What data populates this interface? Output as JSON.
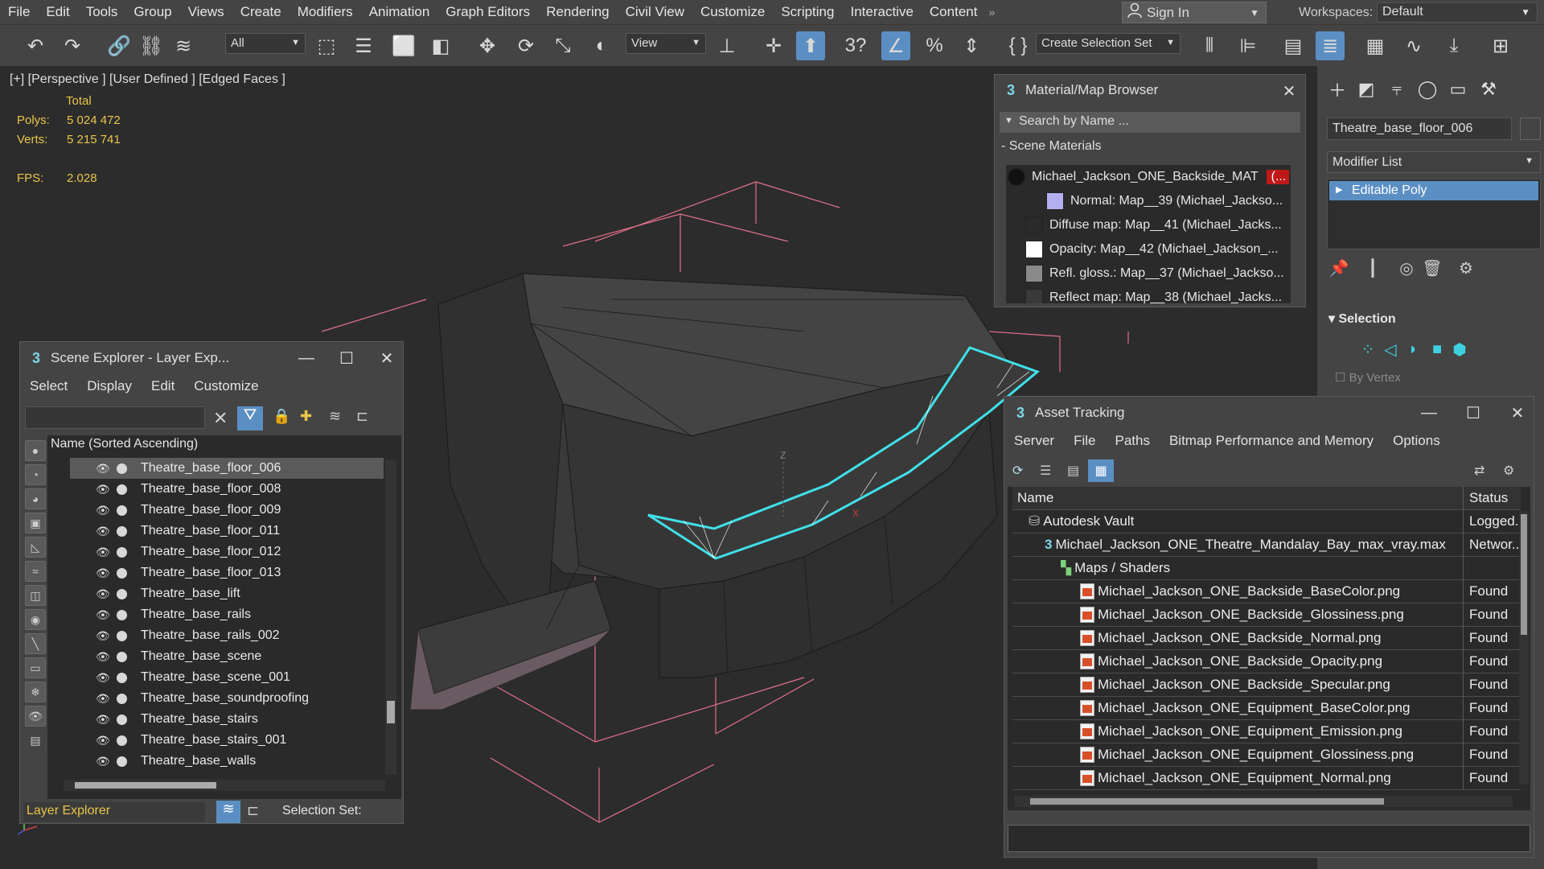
{
  "menubar": {
    "items": [
      "File",
      "Edit",
      "Tools",
      "Group",
      "Views",
      "Create",
      "Modifiers",
      "Animation",
      "Graph Editors",
      "Rendering",
      "Civil View",
      "Customize",
      "Scripting",
      "Interactive",
      "Content"
    ],
    "more": "»",
    "sign_in": "Sign In",
    "workspaces_label": "Workspaces:",
    "workspace_value": "Default"
  },
  "toolbar": {
    "filter_value": "All",
    "view_value": "View",
    "selection_set_placeholder": "Create Selection Set",
    "snap_label": "3",
    "icons": [
      "undo-icon",
      "redo-icon",
      "link-icon",
      "unlink-icon",
      "bind-spacewarp-icon",
      "select-object-icon",
      "select-by-name-icon",
      "rect-region-icon",
      "window-crossing-icon",
      "move-icon",
      "rotate-icon",
      "scale-icon",
      "placement-icon",
      "pivot-icon",
      "manipulate-icon",
      "keyboard-shortcut-icon",
      "snaps-icon",
      "angle-snap-icon",
      "percent-snap-icon",
      "spinner-snap-icon",
      "named-sel-icon",
      "mirror-icon",
      "align-icon",
      "toggle-explorer-icon",
      "toggle-layer-icon",
      "ribbon-icon",
      "curve-editor-icon",
      "schematic-icon",
      "material-editor-icon"
    ]
  },
  "viewport": {
    "label": "[+] [Perspective ] [User Defined ] [Edged Faces ]",
    "stats_header": "Total",
    "polys_label": "Polys:",
    "polys_value": "5 024 472",
    "verts_label": "Verts:",
    "verts_value": "5 215 741",
    "fps_label": "FPS:",
    "fps_value": "2.028"
  },
  "command_panel": {
    "object_name": "Theatre_base_floor_006",
    "modifier_list_label": "Modifier List",
    "modifier_item": "Editable Poly",
    "selection_title": "Selection",
    "by_vertex_label": "By Vertex"
  },
  "material_browser": {
    "title": "Material/Map Browser",
    "search_placeholder": "Search by Name ...",
    "section": "Scene Materials",
    "material": "Michael_Jackson_ONE_Backside_MAT",
    "material_badge": "(...",
    "maps": [
      {
        "label": "Normal: Map__39 (Michael_Jackso...",
        "swatch": "#b4b0f0"
      },
      {
        "label": "Diffuse map: Map__41 (Michael_Jacks...",
        "swatch": "#2a2a2a"
      },
      {
        "label": "Opacity: Map__42 (Michael_Jackson_...",
        "swatch": "#ffffff"
      },
      {
        "label": "Refl. gloss.: Map__37 (Michael_Jackso...",
        "swatch": "#8a8a8a"
      },
      {
        "label": "Reflect map: Map__38 (Michael_Jacks...",
        "swatch": "#3a3a3a"
      }
    ]
  },
  "scene_explorer": {
    "title": "Scene Explorer - Layer Exp...",
    "menu": [
      "Select",
      "Display",
      "Edit",
      "Customize"
    ],
    "column_header": "Name (Sorted Ascending)",
    "rows": [
      "Theatre_base_floor_006",
      "Theatre_base_floor_008",
      "Theatre_base_floor_009",
      "Theatre_base_floor_011",
      "Theatre_base_floor_012",
      "Theatre_base_floor_013",
      "Theatre_base_lift",
      "Theatre_base_rails",
      "Theatre_base_rails_002",
      "Theatre_base_scene",
      "Theatre_base_scene_001",
      "Theatre_base_soundproofing",
      "Theatre_base_stairs",
      "Theatre_base_stairs_001",
      "Theatre_base_walls"
    ],
    "explorer_type": "Layer Explorer",
    "selection_set_label": "Selection Set:"
  },
  "asset_tracking": {
    "title": "Asset Tracking",
    "menu": [
      "Server",
      "File",
      "Paths",
      "Bitmap Performance and Memory",
      "Options"
    ],
    "col_name": "Name",
    "col_status": "Status",
    "rows": [
      {
        "name": "Autodesk Vault",
        "status": "Logged...",
        "indent": 20,
        "icon": "vault"
      },
      {
        "name": "Michael_Jackson_ONE_Theatre_Mandalay_Bay_max_vray.max",
        "status": "Networ...",
        "indent": 40,
        "icon": "max"
      },
      {
        "name": "Maps / Shaders",
        "status": "",
        "indent": 60,
        "icon": "folder"
      },
      {
        "name": "Michael_Jackson_ONE_Backside_BaseColor.png",
        "status": "Found",
        "indent": 80,
        "icon": "png"
      },
      {
        "name": "Michael_Jackson_ONE_Backside_Glossiness.png",
        "status": "Found",
        "indent": 80,
        "icon": "png"
      },
      {
        "name": "Michael_Jackson_ONE_Backside_Normal.png",
        "status": "Found",
        "indent": 80,
        "icon": "png"
      },
      {
        "name": "Michael_Jackson_ONE_Backside_Opacity.png",
        "status": "Found",
        "indent": 80,
        "icon": "png"
      },
      {
        "name": "Michael_Jackson_ONE_Backside_Specular.png",
        "status": "Found",
        "indent": 80,
        "icon": "png"
      },
      {
        "name": "Michael_Jackson_ONE_Equipment_BaseColor.png",
        "status": "Found",
        "indent": 80,
        "icon": "png"
      },
      {
        "name": "Michael_Jackson_ONE_Equipment_Emission.png",
        "status": "Found",
        "indent": 80,
        "icon": "png"
      },
      {
        "name": "Michael_Jackson_ONE_Equipment_Glossiness.png",
        "status": "Found",
        "indent": 80,
        "icon": "png"
      },
      {
        "name": "Michael_Jackson_ONE_Equipment_Normal.png",
        "status": "Found",
        "indent": 80,
        "icon": "png"
      }
    ]
  },
  "colors": {
    "accent": "#5b8fc4",
    "stats": "#e8c54a",
    "selection_outline": "#40e0e8",
    "gizmo_pink": "#e2708a"
  }
}
